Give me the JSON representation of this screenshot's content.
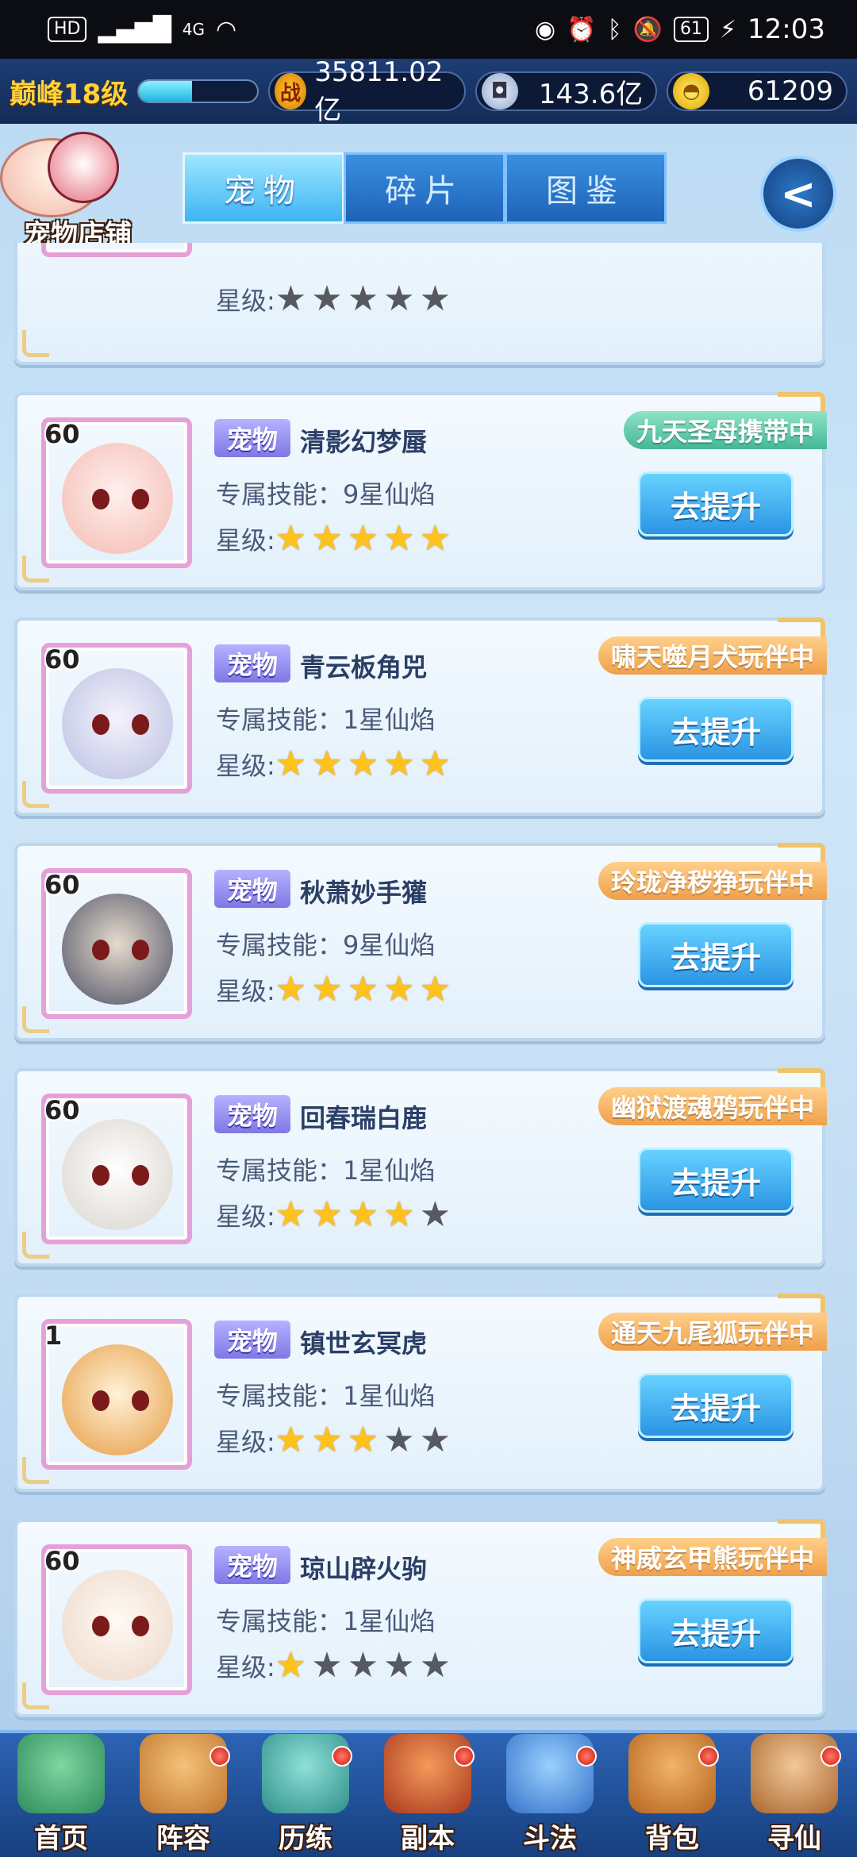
{
  "status_bar": {
    "left_chip": "HD",
    "network": "4G",
    "battery": "61",
    "time": "12:03"
  },
  "resources": {
    "peak_level": "巅峰18级",
    "level_progress": 0.45,
    "power_icon": "战",
    "power": "35811.02亿",
    "coins": "143.6亿",
    "gold": "61209"
  },
  "header": {
    "shop_label": "宠物店铺",
    "tabs": [
      {
        "label": "宠物",
        "active": true
      },
      {
        "label": "碎片",
        "active": false
      },
      {
        "label": "图鉴",
        "active": false
      }
    ],
    "back_icon": "back-arrow-icon"
  },
  "labels": {
    "tag": "宠物",
    "star_prefix": "星级:",
    "upgrade": "去提升"
  },
  "pets": [
    {
      "level": "",
      "name": "",
      "skill": "",
      "stars": 0,
      "status": "",
      "partial": true
    },
    {
      "level": "60",
      "name": "清影幻梦蜃",
      "skill": "专属技能：9星仙焰",
      "stars": 5,
      "status": "九天圣母携带中",
      "status_color": "teal",
      "face": [
        "#fff0ee",
        "#f4b9b0"
      ]
    },
    {
      "level": "60",
      "name": "青云板角兕",
      "skill": "专属技能：1星仙焰",
      "stars": 5,
      "status": "啸天噬月犬玩伴中",
      "status_color": "orange",
      "face": [
        "#f4f2fb",
        "#b9bfe2"
      ]
    },
    {
      "level": "60",
      "name": "秋萧妙手獾",
      "skill": "专属技能：9星仙焰",
      "stars": 5,
      "status": "玲珑净秽狰玩伴中",
      "status_color": "orange",
      "face": [
        "#e6dccd",
        "#4a4d63"
      ]
    },
    {
      "level": "60",
      "name": "回春瑞白鹿",
      "skill": "专属技能：1星仙焰",
      "stars": 4,
      "status": "幽狱渡魂鸦玩伴中",
      "status_color": "orange",
      "face": [
        "#ffffff",
        "#d9d3cc"
      ]
    },
    {
      "level": "1",
      "name": "镇世玄冥虎",
      "skill": "专属技能：1星仙焰",
      "stars": 3,
      "status": "通天九尾狐玩伴中",
      "status_color": "orange",
      "face": [
        "#fff2d8",
        "#e69b40"
      ]
    },
    {
      "level": "60",
      "name": "琼山辟火驹",
      "skill": "专属技能：1星仙焰",
      "stars": 1,
      "status": "神威玄甲熊玩伴中",
      "status_color": "orange",
      "face": [
        "#fffaf3",
        "#ecd6c8"
      ]
    }
  ],
  "bottom_nav": [
    {
      "label": "首页",
      "dot": false,
      "icon": "mountain-island-icon",
      "color": [
        "#7fd6a0",
        "#2d8b5c"
      ]
    },
    {
      "label": "阵容",
      "dot": true,
      "icon": "lineup-cards-icon",
      "color": [
        "#f4c27a",
        "#c0752e"
      ]
    },
    {
      "label": "历练",
      "dot": true,
      "icon": "gourd-icon",
      "color": [
        "#8fe0d8",
        "#2f8f8a"
      ]
    },
    {
      "label": "副本",
      "dot": true,
      "icon": "gate-icon",
      "color": [
        "#f49a5a",
        "#a8381e"
      ]
    },
    {
      "label": "斗法",
      "dot": true,
      "icon": "swords-icon",
      "color": [
        "#9ad0ff",
        "#3572c8"
      ]
    },
    {
      "label": "背包",
      "dot": true,
      "icon": "backpack-icon",
      "color": [
        "#f2b36a",
        "#b5641e"
      ]
    },
    {
      "label": "寻仙",
      "dot": true,
      "icon": "scroll-icon",
      "color": [
        "#f3c89a",
        "#a8662e"
      ]
    }
  ]
}
